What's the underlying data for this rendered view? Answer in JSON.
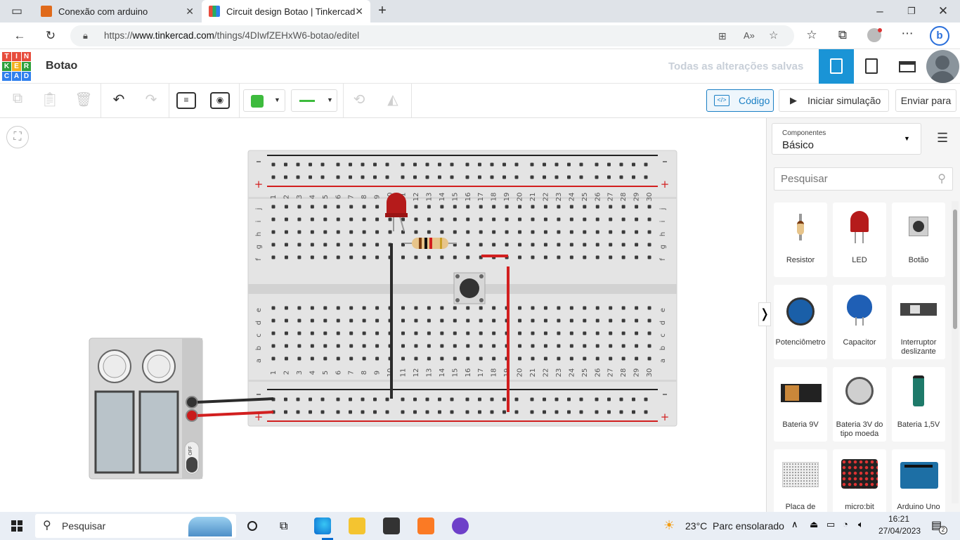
{
  "browser": {
    "tabs": [
      {
        "title": "Conexão com arduino",
        "active": false
      },
      {
        "title": "Circuit design Botao | Tinkercad",
        "active": true
      }
    ],
    "url_prefix": "https://",
    "url_host": "www.tinkercad.com",
    "url_path": "/things/4DIwfZEHxW6-botao/editel"
  },
  "app": {
    "logo": [
      "T",
      "I",
      "N",
      "K",
      "E",
      "R",
      "C",
      "A",
      "D"
    ],
    "project_title": "Botao",
    "save_status": "Todas as alterações salvas"
  },
  "toolbar": {
    "code_label": "Código",
    "simulate_label": "Iniciar simulação",
    "send_label": "Enviar para",
    "fill_color": "#3dbb3d",
    "wire_color": "#3dbb3d"
  },
  "breadboard": {
    "columns": [
      "1",
      "2",
      "3",
      "4",
      "5",
      "6",
      "7",
      "8",
      "9",
      "10",
      "11",
      "12",
      "13",
      "14",
      "15",
      "16",
      "17",
      "18",
      "19",
      "20",
      "21",
      "22",
      "23",
      "24",
      "25",
      "26",
      "27",
      "28",
      "29",
      "30"
    ],
    "rows_top": [
      "j",
      "i",
      "h",
      "g",
      "f"
    ],
    "rows_bottom": [
      "e",
      "d",
      "c",
      "b",
      "a"
    ]
  },
  "power_supply": {
    "off_label": "OFF"
  },
  "panel": {
    "category_caption": "Componentes",
    "category_value": "Básico",
    "search_placeholder": "Pesquisar",
    "components": [
      {
        "name": "Resistor",
        "icon": "resistor-icon"
      },
      {
        "name": "LED",
        "icon": "led-icon"
      },
      {
        "name": "Botão",
        "icon": "button-icon"
      },
      {
        "name": "Potenciômetro",
        "icon": "potentiometer-icon"
      },
      {
        "name": "Capacitor",
        "icon": "capacitor-icon"
      },
      {
        "name": "Interruptor deslizante",
        "icon": "slide-switch-icon"
      },
      {
        "name": "Bateria 9V",
        "icon": "battery-9v-icon"
      },
      {
        "name": "Bateria 3V do tipo moeda",
        "icon": "coin-battery-icon"
      },
      {
        "name": "Bateria 1,5V",
        "icon": "battery-aa-icon"
      },
      {
        "name": "Placa de",
        "icon": "breadboard-icon"
      },
      {
        "name": "micro:bit",
        "icon": "microbit-icon"
      },
      {
        "name": "Arduino Uno",
        "icon": "arduino-icon"
      }
    ]
  },
  "taskbar": {
    "search_label": "Pesquisar",
    "weather_temp": "23°C",
    "weather_text": "Parc ensolarado",
    "time": "16:21",
    "date": "27/04/2023",
    "notification_count": "2"
  }
}
